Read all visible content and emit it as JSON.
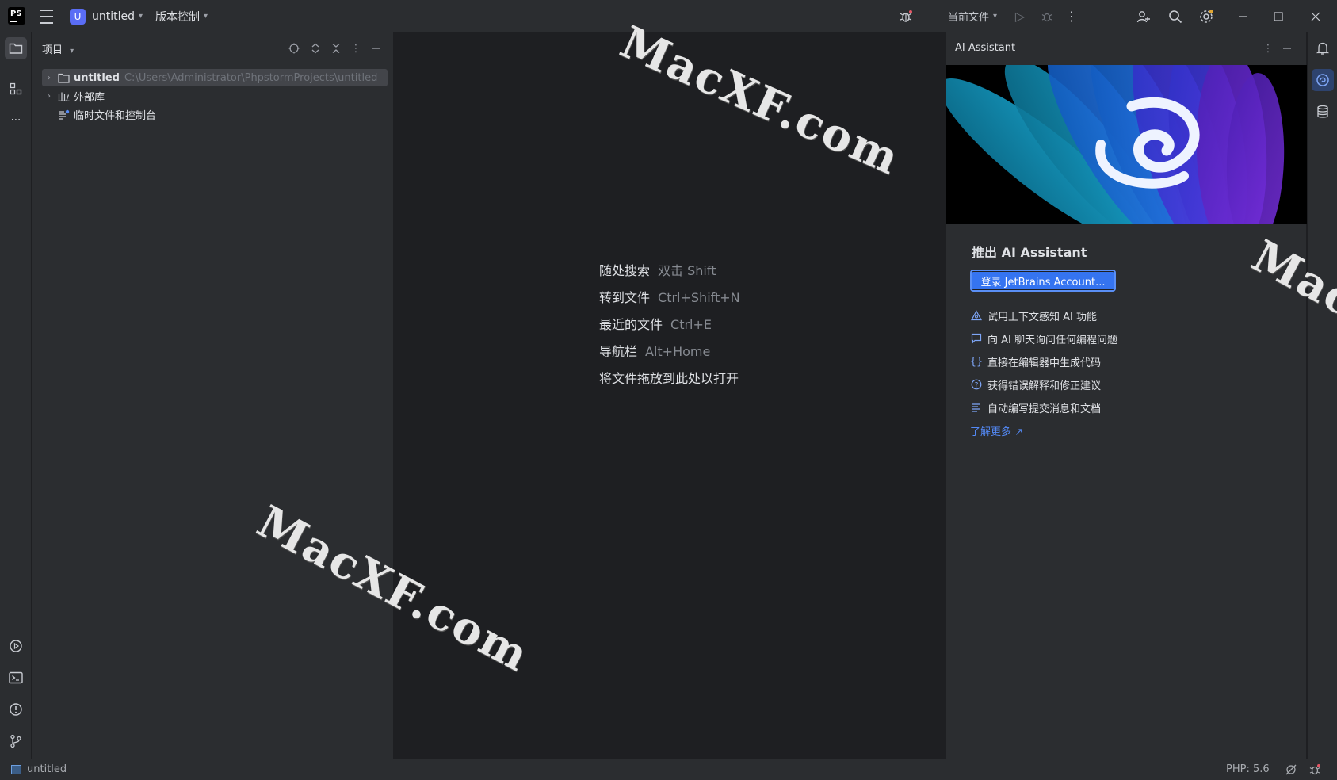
{
  "titlebar": {
    "logo_text": "PS",
    "project_badge": "U",
    "project_name": "untitled",
    "vcs_label": "版本控制",
    "run_config": "当前文件"
  },
  "project_panel": {
    "title": "项目",
    "tree": [
      {
        "label": "untitled",
        "path": "C:\\Users\\Administrator\\PhpstormProjects\\untitled"
      },
      {
        "label": "外部库"
      },
      {
        "label": "临时文件和控制台"
      }
    ]
  },
  "editor_hints": [
    {
      "action": "随处搜索",
      "shortcut": "双击 Shift"
    },
    {
      "action": "转到文件",
      "shortcut": "Ctrl+Shift+N"
    },
    {
      "action": "最近的文件",
      "shortcut": "Ctrl+E"
    },
    {
      "action": "导航栏",
      "shortcut": "Alt+Home"
    },
    {
      "action": "将文件拖放到此处以打开",
      "shortcut": ""
    }
  ],
  "ai_panel": {
    "title": "AI Assistant",
    "heading": "推出 AI Assistant",
    "login_button": "登录 JetBrains Account...",
    "features": [
      "试用上下文感知 AI 功能",
      "向 AI 聊天询问任何编程问题",
      "直接在编辑器中生成代码",
      "获得错误解释和修正建议",
      "自动编写提交消息和文档"
    ],
    "learn_more": "了解更多 ↗"
  },
  "statusbar": {
    "project": "untitled",
    "php_version": "PHP: 5.6"
  },
  "watermarks": [
    "MacXF.com",
    "MacXF.com",
    "Mac"
  ],
  "colors": {
    "accent": "#3574f0",
    "link": "#548af7",
    "background": "#1e1f22",
    "panel": "#2b2d30"
  }
}
